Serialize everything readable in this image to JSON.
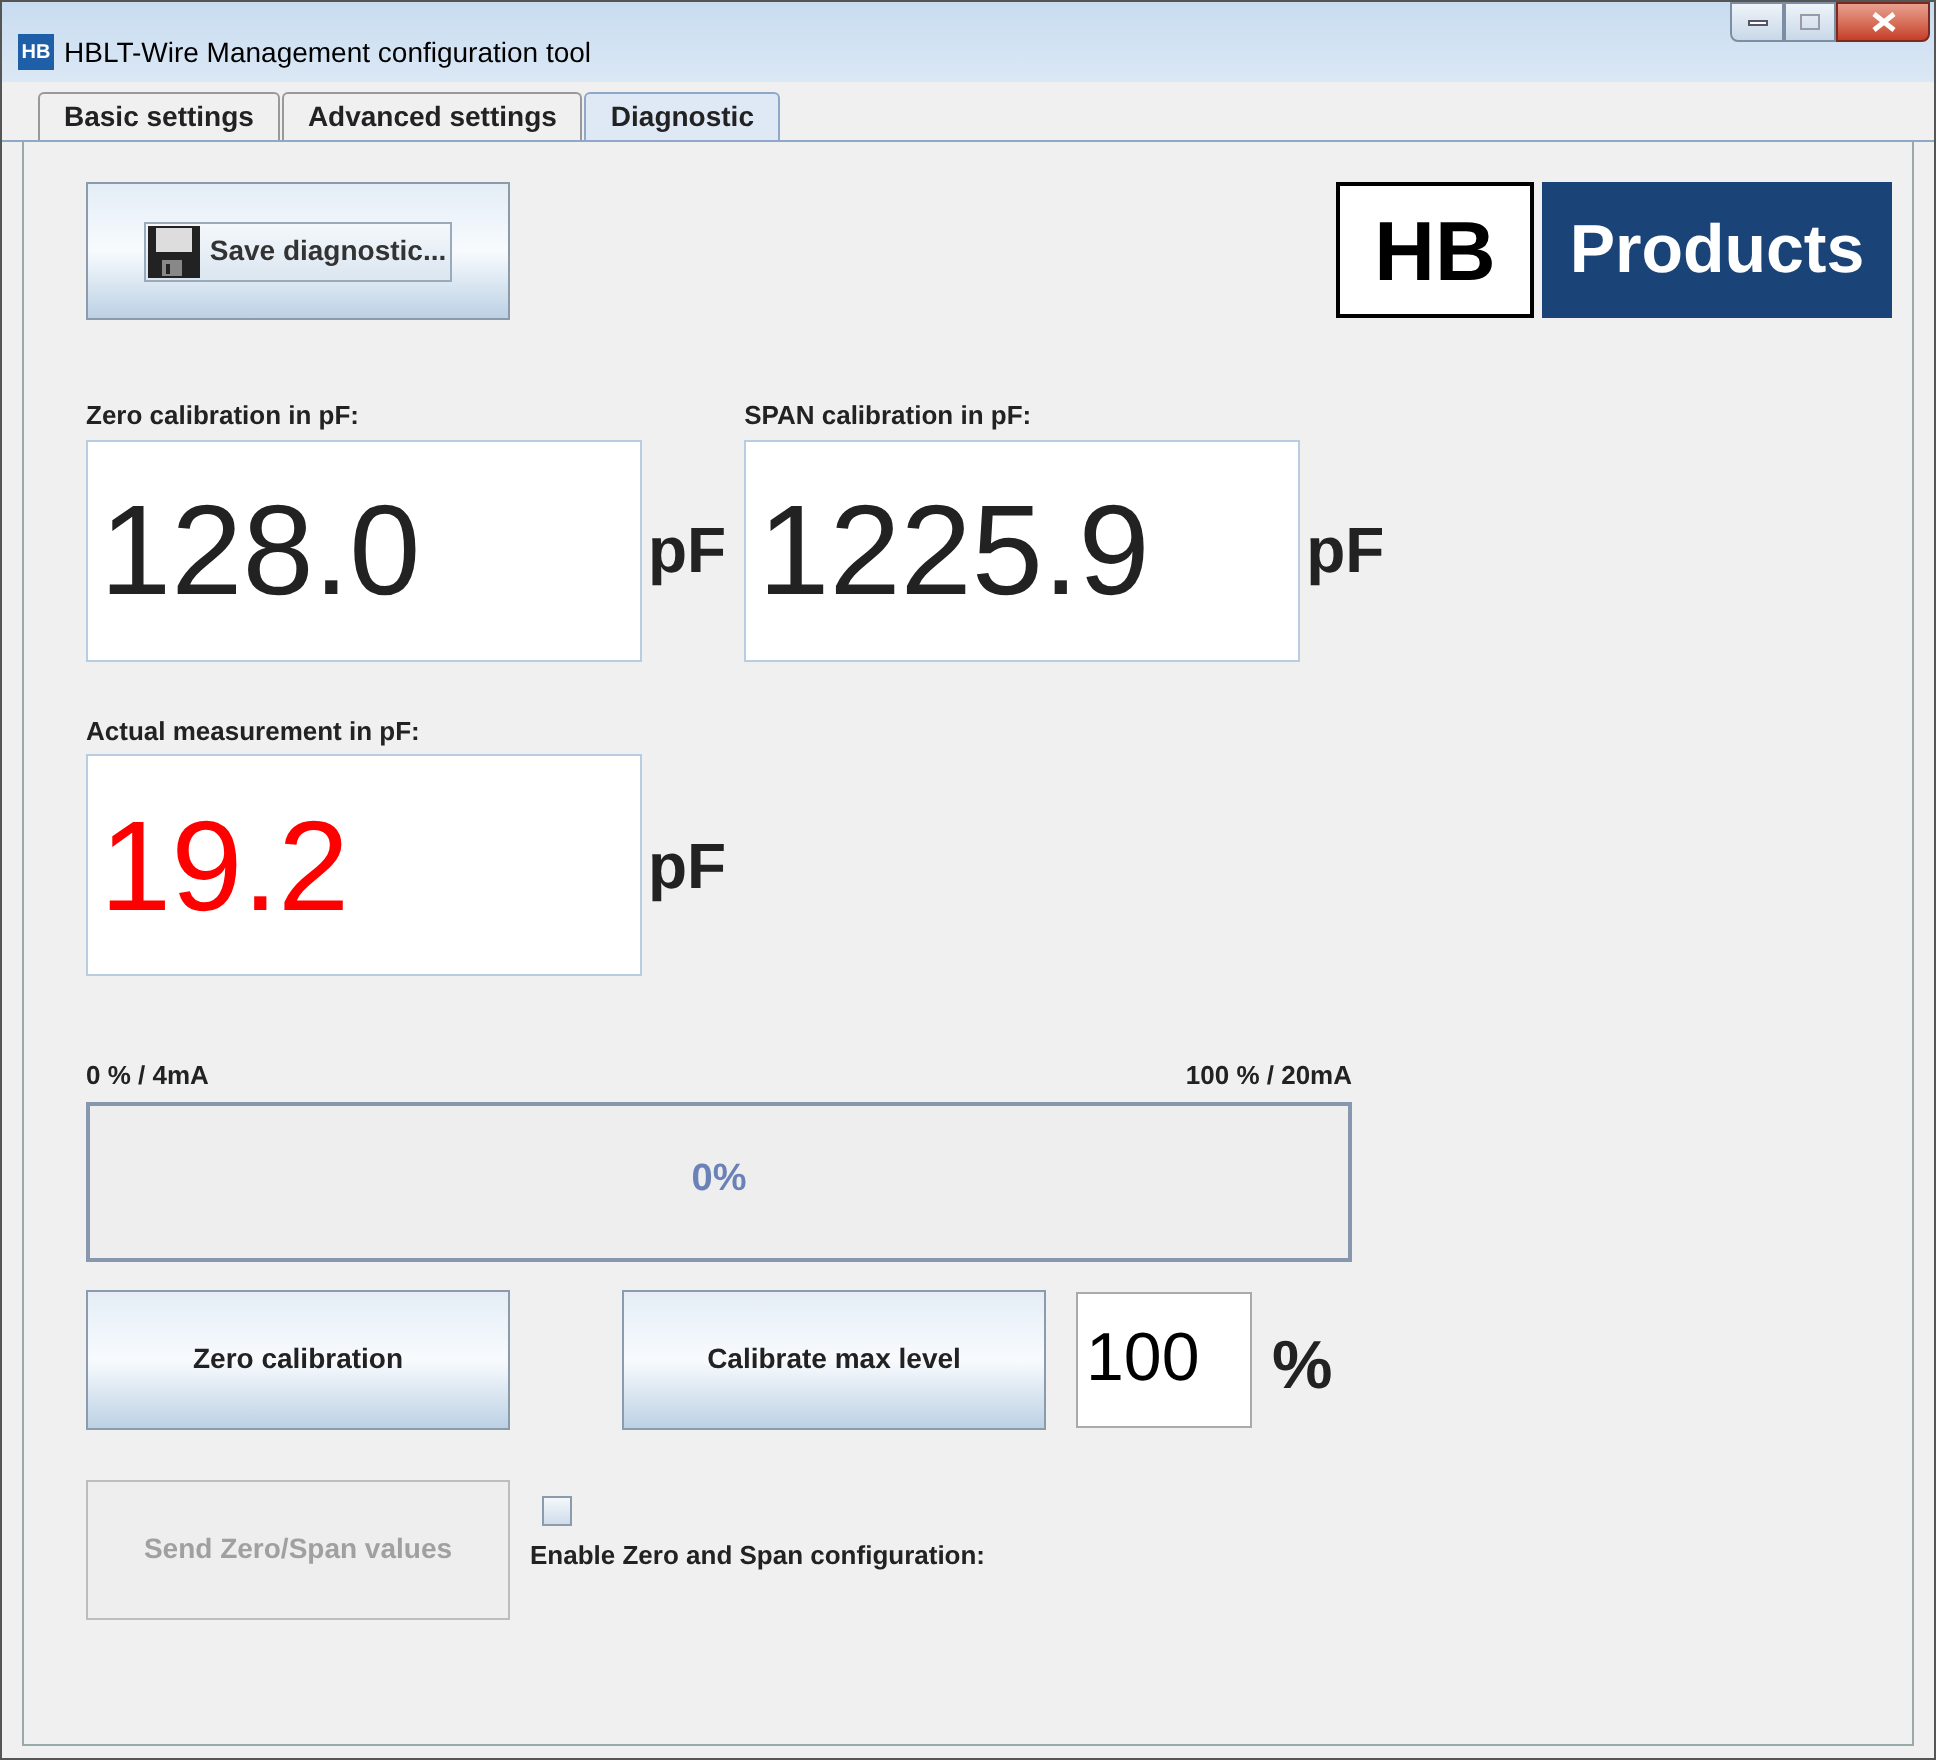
{
  "window": {
    "app_icon": "HB",
    "title": "HBLT-Wire Management configuration tool"
  },
  "tabs": [
    {
      "label": "Basic settings",
      "selected": false
    },
    {
      "label": "Advanced settings",
      "selected": false
    },
    {
      "label": "Diagnostic",
      "selected": true
    }
  ],
  "save_button": {
    "label": "Save diagnostic..."
  },
  "logo": {
    "left": "HB",
    "right": "Products"
  },
  "readings": [
    {
      "label": "Zero calibration in pF:",
      "value": "128.0",
      "unit": "pF",
      "color": "#222222"
    },
    {
      "label": "SPAN calibration in pF:",
      "value": "1225.9",
      "unit": "pF",
      "color": "#222222"
    },
    {
      "label": "Actual measurement in pF:",
      "value": "19.2",
      "unit": "pF",
      "color": "#ff0000"
    }
  ],
  "progress": {
    "min_label": "0 % / 4mA",
    "max_label": "100 % / 20mA",
    "level": 0,
    "text": "0%"
  },
  "calibration_buttons": [
    {
      "label": "Zero calibration",
      "disabled": false
    },
    {
      "label": "Calibrate max level",
      "disabled": false
    }
  ],
  "max_level_field": {
    "value": "100",
    "unit": "%"
  },
  "send_button": {
    "label": "Send Zero/Span values",
    "disabled": true
  },
  "enable_checkbox": {
    "label": "Enable Zero and Span configuration:",
    "checked": false
  }
}
